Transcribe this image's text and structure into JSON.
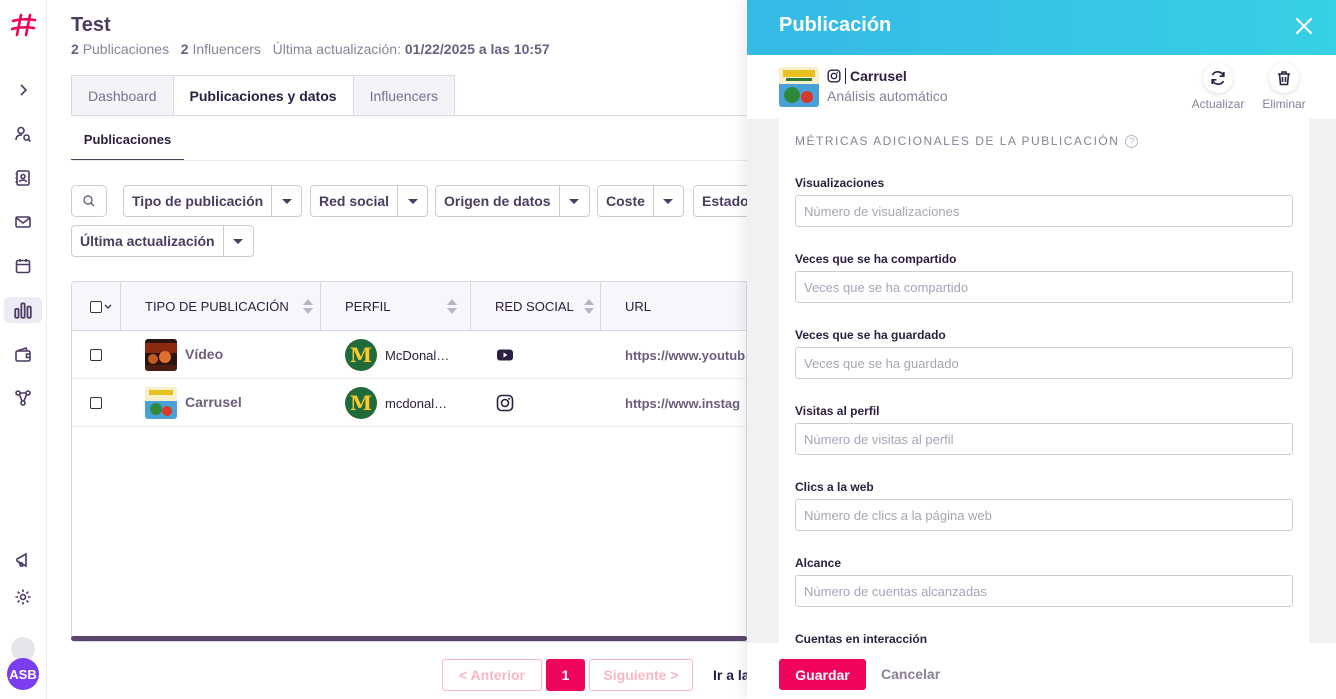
{
  "app": {
    "logo": "hashtag-logo",
    "avatar_initials": "ASB"
  },
  "rail": {
    "icons": [
      "chevron-right-icon",
      "user-search-icon",
      "contacts-icon",
      "mail-icon",
      "calendar-icon",
      "bar-chart-icon",
      "wallet-icon",
      "network-icon",
      "megaphone-icon",
      "gear-icon"
    ]
  },
  "header": {
    "title": "Test",
    "pub_count": "2",
    "pub_label": "Publicaciones",
    "inf_count": "2",
    "inf_label": "Influencers",
    "updated_label": "Última actualización:",
    "updated_value": "01/22/2025 a las 10:57"
  },
  "tabs": [
    {
      "label": "Dashboard"
    },
    {
      "label": "Publicaciones y datos"
    },
    {
      "label": "Influencers"
    }
  ],
  "subtab": "Publicaciones",
  "filters": {
    "type": "Tipo de publicación",
    "network": "Red social",
    "origin": "Origen de datos",
    "cost": "Coste",
    "status": "Estado",
    "updated": "Última actualización"
  },
  "table": {
    "columns": [
      "TIPO DE PUBLICACIÓN",
      "PERFIL",
      "RED SOCIAL",
      "URL"
    ],
    "rows": [
      {
        "type": "Vídeo",
        "profile": "McDonal…",
        "network": "youtube-icon",
        "url": "https://www.youtub"
      },
      {
        "type": "Carrusel",
        "profile": "mcdonal…",
        "network": "instagram-icon",
        "url": "https://www.instag"
      }
    ]
  },
  "pagination": {
    "prev": "< Anterior",
    "current": "1",
    "next": "Siguiente >",
    "goto": "Ir a la"
  },
  "panel": {
    "title": "Publicación",
    "post_name": "Carrusel",
    "post_sub": "Análisis automático",
    "refresh": "Actualizar",
    "delete": "Eliminar",
    "section": "MÉTRICAS ADICIONALES DE LA PUBLICACIÓN",
    "help": "?",
    "fields": [
      {
        "label": "Visualizaciones",
        "placeholder": "Número de visualizaciones"
      },
      {
        "label": "Veces que se ha compartido",
        "placeholder": "Veces que se ha compartido"
      },
      {
        "label": "Veces que se ha guardado",
        "placeholder": "Veces que se ha guardado"
      },
      {
        "label": "Visitas al perfil",
        "placeholder": "Número de visitas al perfil"
      },
      {
        "label": "Clics a la web",
        "placeholder": "Número de clics a la página web"
      },
      {
        "label": "Alcance",
        "placeholder": "Número de cuentas alcanzadas"
      },
      {
        "label": "Cuentas en interacción",
        "placeholder": ""
      }
    ],
    "save": "Guardar",
    "cancel": "Cancelar"
  },
  "colors": {
    "accent": "#f0055e",
    "panel_header": "#35b9e6",
    "text": "#2c2040"
  }
}
